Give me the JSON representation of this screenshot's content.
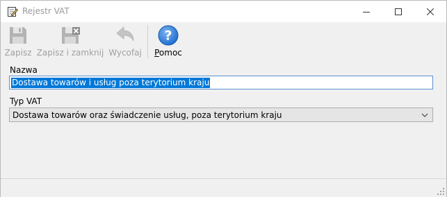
{
  "window": {
    "title": "Rejestr VAT",
    "icon": "edit-document-icon",
    "controls": [
      "minimize-icon",
      "maximize-icon",
      "close-icon"
    ]
  },
  "toolbar": {
    "buttons": [
      {
        "label": "Zapisz",
        "icon": "floppy-disk-icon",
        "enabled": false
      },
      {
        "label": "Zapisz i zamknij",
        "icon": "floppy-disk-close-icon",
        "enabled": false
      },
      {
        "label": "Wycofaj",
        "icon": "undo-arrow-icon",
        "enabled": false
      },
      {
        "label": "Pomoc",
        "icon": "help-question-icon",
        "enabled": true
      }
    ]
  },
  "form": {
    "name_label": "Nazwa",
    "name_value": "Dostawa towarów i usług poza terytorium kraju",
    "vat_type_label": "Typ VAT",
    "vat_type_value": "Dostawa towarów oraz świadczenie usług, poza terytorium kraju"
  },
  "colors": {
    "selection": "#0078d7",
    "help_icon": "#1f6fd0",
    "input_focus_border": "#5a8fd1"
  }
}
